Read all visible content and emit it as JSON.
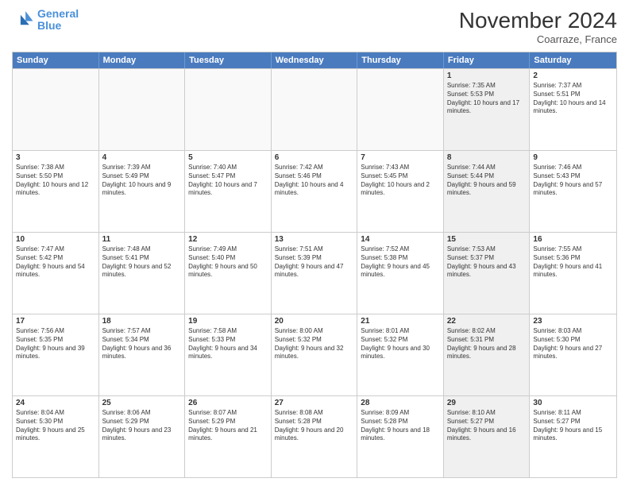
{
  "logo": {
    "line1": "General",
    "line2": "Blue"
  },
  "title": "November 2024",
  "location": "Coarraze, France",
  "header_days": [
    "Sunday",
    "Monday",
    "Tuesday",
    "Wednesday",
    "Thursday",
    "Friday",
    "Saturday"
  ],
  "weeks": [
    [
      {
        "day": "",
        "info": "",
        "empty": true
      },
      {
        "day": "",
        "info": "",
        "empty": true
      },
      {
        "day": "",
        "info": "",
        "empty": true
      },
      {
        "day": "",
        "info": "",
        "empty": true
      },
      {
        "day": "",
        "info": "",
        "empty": true
      },
      {
        "day": "1",
        "info": "Sunrise: 7:35 AM\nSunset: 5:53 PM\nDaylight: 10 hours and 17 minutes.",
        "shaded": true
      },
      {
        "day": "2",
        "info": "Sunrise: 7:37 AM\nSunset: 5:51 PM\nDaylight: 10 hours and 14 minutes.",
        "shaded": false
      }
    ],
    [
      {
        "day": "3",
        "info": "Sunrise: 7:38 AM\nSunset: 5:50 PM\nDaylight: 10 hours and 12 minutes.",
        "shaded": false
      },
      {
        "day": "4",
        "info": "Sunrise: 7:39 AM\nSunset: 5:49 PM\nDaylight: 10 hours and 9 minutes.",
        "shaded": false
      },
      {
        "day": "5",
        "info": "Sunrise: 7:40 AM\nSunset: 5:47 PM\nDaylight: 10 hours and 7 minutes.",
        "shaded": false
      },
      {
        "day": "6",
        "info": "Sunrise: 7:42 AM\nSunset: 5:46 PM\nDaylight: 10 hours and 4 minutes.",
        "shaded": false
      },
      {
        "day": "7",
        "info": "Sunrise: 7:43 AM\nSunset: 5:45 PM\nDaylight: 10 hours and 2 minutes.",
        "shaded": false
      },
      {
        "day": "8",
        "info": "Sunrise: 7:44 AM\nSunset: 5:44 PM\nDaylight: 9 hours and 59 minutes.",
        "shaded": true
      },
      {
        "day": "9",
        "info": "Sunrise: 7:46 AM\nSunset: 5:43 PM\nDaylight: 9 hours and 57 minutes.",
        "shaded": false
      }
    ],
    [
      {
        "day": "10",
        "info": "Sunrise: 7:47 AM\nSunset: 5:42 PM\nDaylight: 9 hours and 54 minutes.",
        "shaded": false
      },
      {
        "day": "11",
        "info": "Sunrise: 7:48 AM\nSunset: 5:41 PM\nDaylight: 9 hours and 52 minutes.",
        "shaded": false
      },
      {
        "day": "12",
        "info": "Sunrise: 7:49 AM\nSunset: 5:40 PM\nDaylight: 9 hours and 50 minutes.",
        "shaded": false
      },
      {
        "day": "13",
        "info": "Sunrise: 7:51 AM\nSunset: 5:39 PM\nDaylight: 9 hours and 47 minutes.",
        "shaded": false
      },
      {
        "day": "14",
        "info": "Sunrise: 7:52 AM\nSunset: 5:38 PM\nDaylight: 9 hours and 45 minutes.",
        "shaded": false
      },
      {
        "day": "15",
        "info": "Sunrise: 7:53 AM\nSunset: 5:37 PM\nDaylight: 9 hours and 43 minutes.",
        "shaded": true
      },
      {
        "day": "16",
        "info": "Sunrise: 7:55 AM\nSunset: 5:36 PM\nDaylight: 9 hours and 41 minutes.",
        "shaded": false
      }
    ],
    [
      {
        "day": "17",
        "info": "Sunrise: 7:56 AM\nSunset: 5:35 PM\nDaylight: 9 hours and 39 minutes.",
        "shaded": false
      },
      {
        "day": "18",
        "info": "Sunrise: 7:57 AM\nSunset: 5:34 PM\nDaylight: 9 hours and 36 minutes.",
        "shaded": false
      },
      {
        "day": "19",
        "info": "Sunrise: 7:58 AM\nSunset: 5:33 PM\nDaylight: 9 hours and 34 minutes.",
        "shaded": false
      },
      {
        "day": "20",
        "info": "Sunrise: 8:00 AM\nSunset: 5:32 PM\nDaylight: 9 hours and 32 minutes.",
        "shaded": false
      },
      {
        "day": "21",
        "info": "Sunrise: 8:01 AM\nSunset: 5:32 PM\nDaylight: 9 hours and 30 minutes.",
        "shaded": false
      },
      {
        "day": "22",
        "info": "Sunrise: 8:02 AM\nSunset: 5:31 PM\nDaylight: 9 hours and 28 minutes.",
        "shaded": true
      },
      {
        "day": "23",
        "info": "Sunrise: 8:03 AM\nSunset: 5:30 PM\nDaylight: 9 hours and 27 minutes.",
        "shaded": false
      }
    ],
    [
      {
        "day": "24",
        "info": "Sunrise: 8:04 AM\nSunset: 5:30 PM\nDaylight: 9 hours and 25 minutes.",
        "shaded": false
      },
      {
        "day": "25",
        "info": "Sunrise: 8:06 AM\nSunset: 5:29 PM\nDaylight: 9 hours and 23 minutes.",
        "shaded": false
      },
      {
        "day": "26",
        "info": "Sunrise: 8:07 AM\nSunset: 5:29 PM\nDaylight: 9 hours and 21 minutes.",
        "shaded": false
      },
      {
        "day": "27",
        "info": "Sunrise: 8:08 AM\nSunset: 5:28 PM\nDaylight: 9 hours and 20 minutes.",
        "shaded": false
      },
      {
        "day": "28",
        "info": "Sunrise: 8:09 AM\nSunset: 5:28 PM\nDaylight: 9 hours and 18 minutes.",
        "shaded": false
      },
      {
        "day": "29",
        "info": "Sunrise: 8:10 AM\nSunset: 5:27 PM\nDaylight: 9 hours and 16 minutes.",
        "shaded": true
      },
      {
        "day": "30",
        "info": "Sunrise: 8:11 AM\nSunset: 5:27 PM\nDaylight: 9 hours and 15 minutes.",
        "shaded": false
      }
    ]
  ]
}
